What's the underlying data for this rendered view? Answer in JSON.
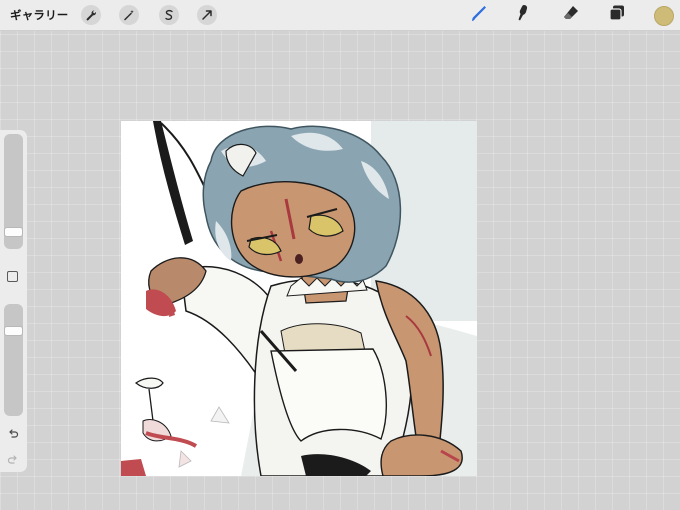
{
  "toolbar": {
    "gallery_label": "ギャラリー",
    "left_tools": [
      "wrench-icon",
      "magic-wand-icon",
      "selection-icon",
      "transform-arrow-icon"
    ],
    "right_tools": [
      "brush-icon",
      "smudge-icon",
      "eraser-icon",
      "layers-icon"
    ],
    "active_tool": "brush-icon",
    "active_tool_color": "#2f6fe0",
    "current_color": "#cdbb77"
  },
  "sidebar": {
    "brush_size_level": 0.76,
    "opacity_level": 0.25,
    "icons": [
      "modify-square-icon",
      "undo-icon",
      "redo-icon"
    ]
  },
  "canvas": {
    "artwork": "drawing-canvas"
  }
}
